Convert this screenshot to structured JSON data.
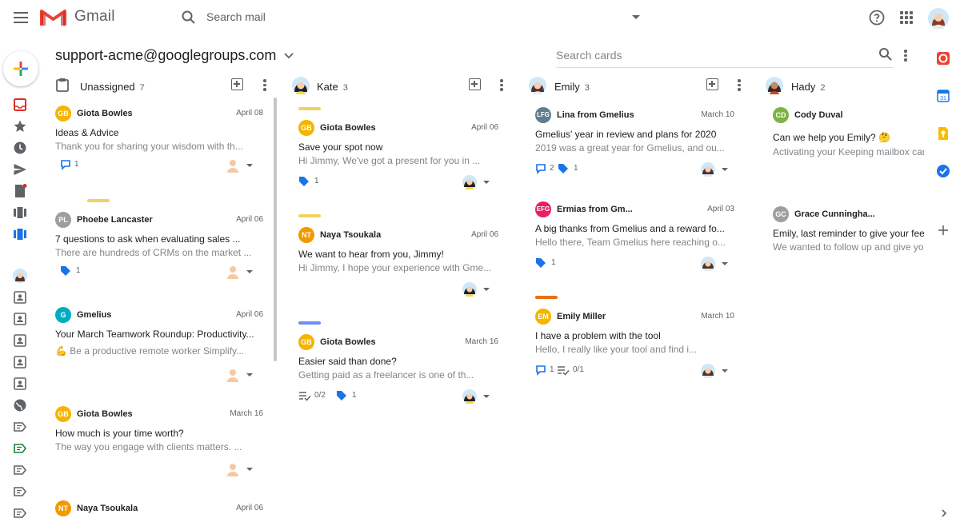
{
  "app": {
    "name": "Gmail",
    "search_placeholder": "Search mail"
  },
  "board": {
    "title": "support-acme@googlegroups.com",
    "search_placeholder": "Search cards"
  },
  "columns": [
    {
      "name": "Unassigned",
      "count": "7",
      "cards": [
        {
          "sender": "Giota Bowles",
          "initials": "GB",
          "color": "#f4b400",
          "date": "April 08",
          "subject": "Ideas & Advice",
          "snippet": "Thank you for sharing your wisdom with th...",
          "comments": "1",
          "label_color": ""
        },
        {
          "sender": "Phoebe Lancaster",
          "initials": "PL",
          "color": "#9e9e9e",
          "date": "April 06",
          "subject": "7 questions to ask when evaluating sales ...",
          "snippet": "There are hundreds of CRMs on the market ...",
          "tags": "1",
          "label_color": "#f0d264"
        },
        {
          "sender": "Gmelius",
          "initials": "G",
          "color": "#00acc1",
          "date": "April 06",
          "subject": "Your March Teamwork Roundup: Productivity...",
          "snippet": "💪  Be a productive remote worker Simplify...",
          "label_color": ""
        },
        {
          "sender": "Giota Bowles",
          "initials": "GB",
          "color": "#f4b400",
          "date": "March 16",
          "subject": "How much is your time worth?",
          "snippet": "The way you engage with clients matters. ...",
          "label_color": ""
        },
        {
          "sender": "Naya Tsoukala",
          "initials": "NT",
          "color": "#f29900",
          "date": "April 06",
          "label_color": ""
        }
      ]
    },
    {
      "name": "Kate",
      "count": "3",
      "cards": [
        {
          "sender": "Giota Bowles",
          "initials": "GB",
          "color": "#f4b400",
          "date": "April 06",
          "subject": "Save your spot now",
          "snippet": "Hi Jimmy, We've got a present for you in ...",
          "tags": "1",
          "label_color": "#f0d264"
        },
        {
          "sender": "Naya Tsoukala",
          "initials": "NT",
          "color": "#f29900",
          "date": "April 06",
          "subject": "We want to hear from you, Jimmy!",
          "snippet": "Hi Jimmy, I hope your experience with Gme...",
          "label_color": "#f0d264"
        },
        {
          "sender": "Giota Bowles",
          "initials": "GB",
          "color": "#f4b400",
          "date": "March 16",
          "subject": "Easier said than done?",
          "snippet": "Getting paid as a freelancer is one of th...",
          "tasks": "0/2",
          "tags": "1",
          "label_color": "#6a8ff0"
        }
      ]
    },
    {
      "name": "Emily",
      "count": "3",
      "cards": [
        {
          "sender": "Lina from Gmelius",
          "initials": "LFG",
          "color": "#607d8b",
          "date": "March 10",
          "subject": "Gmelius' year in review and plans for 2020",
          "snippet": "2019 was a great year for Gmelius, and ou...",
          "comments": "2",
          "tags": "1",
          "label_color": ""
        },
        {
          "sender": "Ermias from Gm...",
          "initials": "EFG",
          "color": "#e91e63",
          "date": "April 03",
          "subject": "A big thanks from Gmelius and a reward fo...",
          "snippet": "Hello there, Team Gmelius here reaching o...",
          "tags": "1",
          "label_color": ""
        },
        {
          "sender": "Emily Miller",
          "initials": "EM",
          "color": "#f4b400",
          "date": "March 10",
          "subject": "I have a problem with the tool",
          "snippet": "Hello, I really like your tool and find i...",
          "comments": "1",
          "tasks": "0/1",
          "label_color": "#e8711a"
        }
      ]
    },
    {
      "name": "Hady",
      "count": "2",
      "cards": [
        {
          "sender": "Cody Duval",
          "initials": "CD",
          "color": "#7cb342",
          "subject": "Can we help you Emily? 🤔",
          "snippet": "Activating your Keeping mailbox car",
          "label_color": ""
        },
        {
          "sender": "Grace Cunningha...",
          "initials": "GC",
          "color": "#9e9e9e",
          "subject": "Emily, last reminder to give your fee",
          "snippet": "We wanted to follow up and give you",
          "label_color": ""
        }
      ]
    }
  ],
  "colors": {
    "accent_red": "#ea4335",
    "icon_gray": "#5f6368",
    "tag_blue": "#1a73e8"
  }
}
